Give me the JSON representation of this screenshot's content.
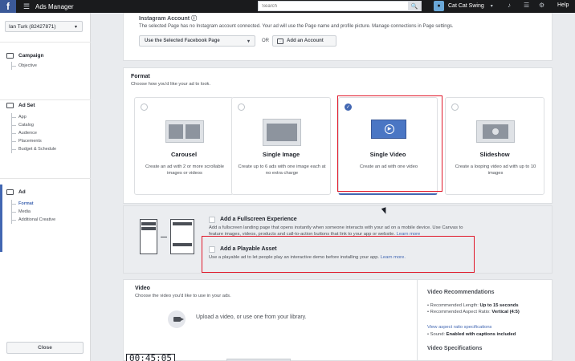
{
  "topbar": {
    "logo": "f",
    "menu_glyph": "☰",
    "app_title": "Ads Manager",
    "search_placeholder": "Search",
    "search_glyph": "🔍",
    "account_name": "Cat Cat Swing",
    "account_caret": "▾",
    "help": "Help"
  },
  "sidebar": {
    "ad_account": "Ian Turk (82427871)",
    "caret": "▾",
    "campaign": {
      "label": "Campaign",
      "items": [
        "Objective"
      ]
    },
    "adset": {
      "label": "Ad Set",
      "items": [
        "App",
        "Catalog",
        "Audience",
        "Placements",
        "Budget & Schedule"
      ]
    },
    "ad": {
      "label": "Ad",
      "items": [
        "Format",
        "Media",
        "Additional Creative"
      ],
      "active_item": "Format"
    },
    "close_label": "Close"
  },
  "instagram": {
    "title": "Instagram Account",
    "info_glyph": "ⓘ",
    "description": "The selected Page has no Instagram account connected. Your ad will use the Page name and profile picture. Manage connections in Page settings.",
    "select_label": "Use the Selected Facebook Page",
    "caret": "▾",
    "or_label": "OR",
    "add_account_label": "Add an Account"
  },
  "format": {
    "title": "Format",
    "subtitle": "Choose how you'd like your ad to look.",
    "options": [
      {
        "name": "Carousel",
        "description": "Create an ad with 2 or more scrollable images or videos",
        "selected": false
      },
      {
        "name": "Single Image",
        "description": "Create up to 6 ads with one image each at no extra charge",
        "selected": false
      },
      {
        "name": "Single Video",
        "description": "Create an ad with one video",
        "selected": true
      },
      {
        "name": "Slideshow",
        "description": "Create a looping video ad with up to 10 images",
        "selected": false
      }
    ],
    "check_glyph": "✓",
    "play_glyph": "▶"
  },
  "canvas": {
    "fullscreen_title": "Add a Fullscreen Experience",
    "fullscreen_desc_1": "Add a fullscreen landing page that opens instantly when someone interacts with your ad on a mobile device. Use Canvas to",
    "fullscreen_desc_2": "feature images, videos, products and call-to-action buttons that link to your app or website.",
    "fullscreen_link": "Learn more",
    "playable_title": "Add a Playable Asset",
    "playable_desc": "Use a playable ad to let people play an interactive demo before installing your app.",
    "playable_link": "Learn more."
  },
  "video": {
    "title": "Video",
    "subtitle": "Choose the video you'd like to use in your ads.",
    "upload_text": "Upload a video, or use one from your library.",
    "timestamp": "00:45:05",
    "recommendations_title": "Video Recommendations",
    "rec_length_label": "Recommended Length:",
    "rec_length_value": "Up to 15 seconds",
    "rec_ratio_label": "Recommended Aspect Ratio:",
    "rec_ratio_value": "Vertical (4:5)",
    "rec_ratio_link": "View aspect ratio specifications",
    "rec_sound_label": "Sound:",
    "rec_sound_value": "Enabled with captions included",
    "specs_title": "Video Specifications",
    "bullet": "•"
  },
  "colors": {
    "accent": "#4267b2",
    "highlight": "#e0182a",
    "topbar": "#1a1b1d"
  }
}
